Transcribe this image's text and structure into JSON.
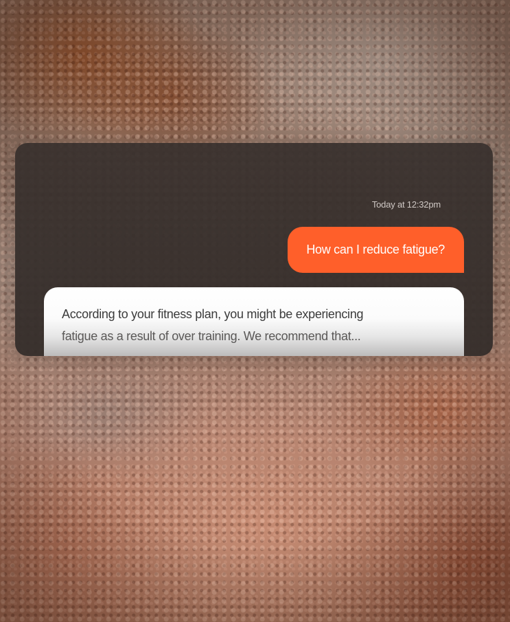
{
  "chat": {
    "timestamp": "Today at 12:32pm",
    "user_message": "How can I reduce fatigue?",
    "assistant_reply": {
      "line1": "According to your fitness plan, you might be experiencing",
      "line2": "fatigue as a result of over training. We recommend that..."
    }
  },
  "colors": {
    "user_bubble": "#ff5f2a",
    "panel": "#38302d",
    "reply_bubble": "#ffffff"
  }
}
